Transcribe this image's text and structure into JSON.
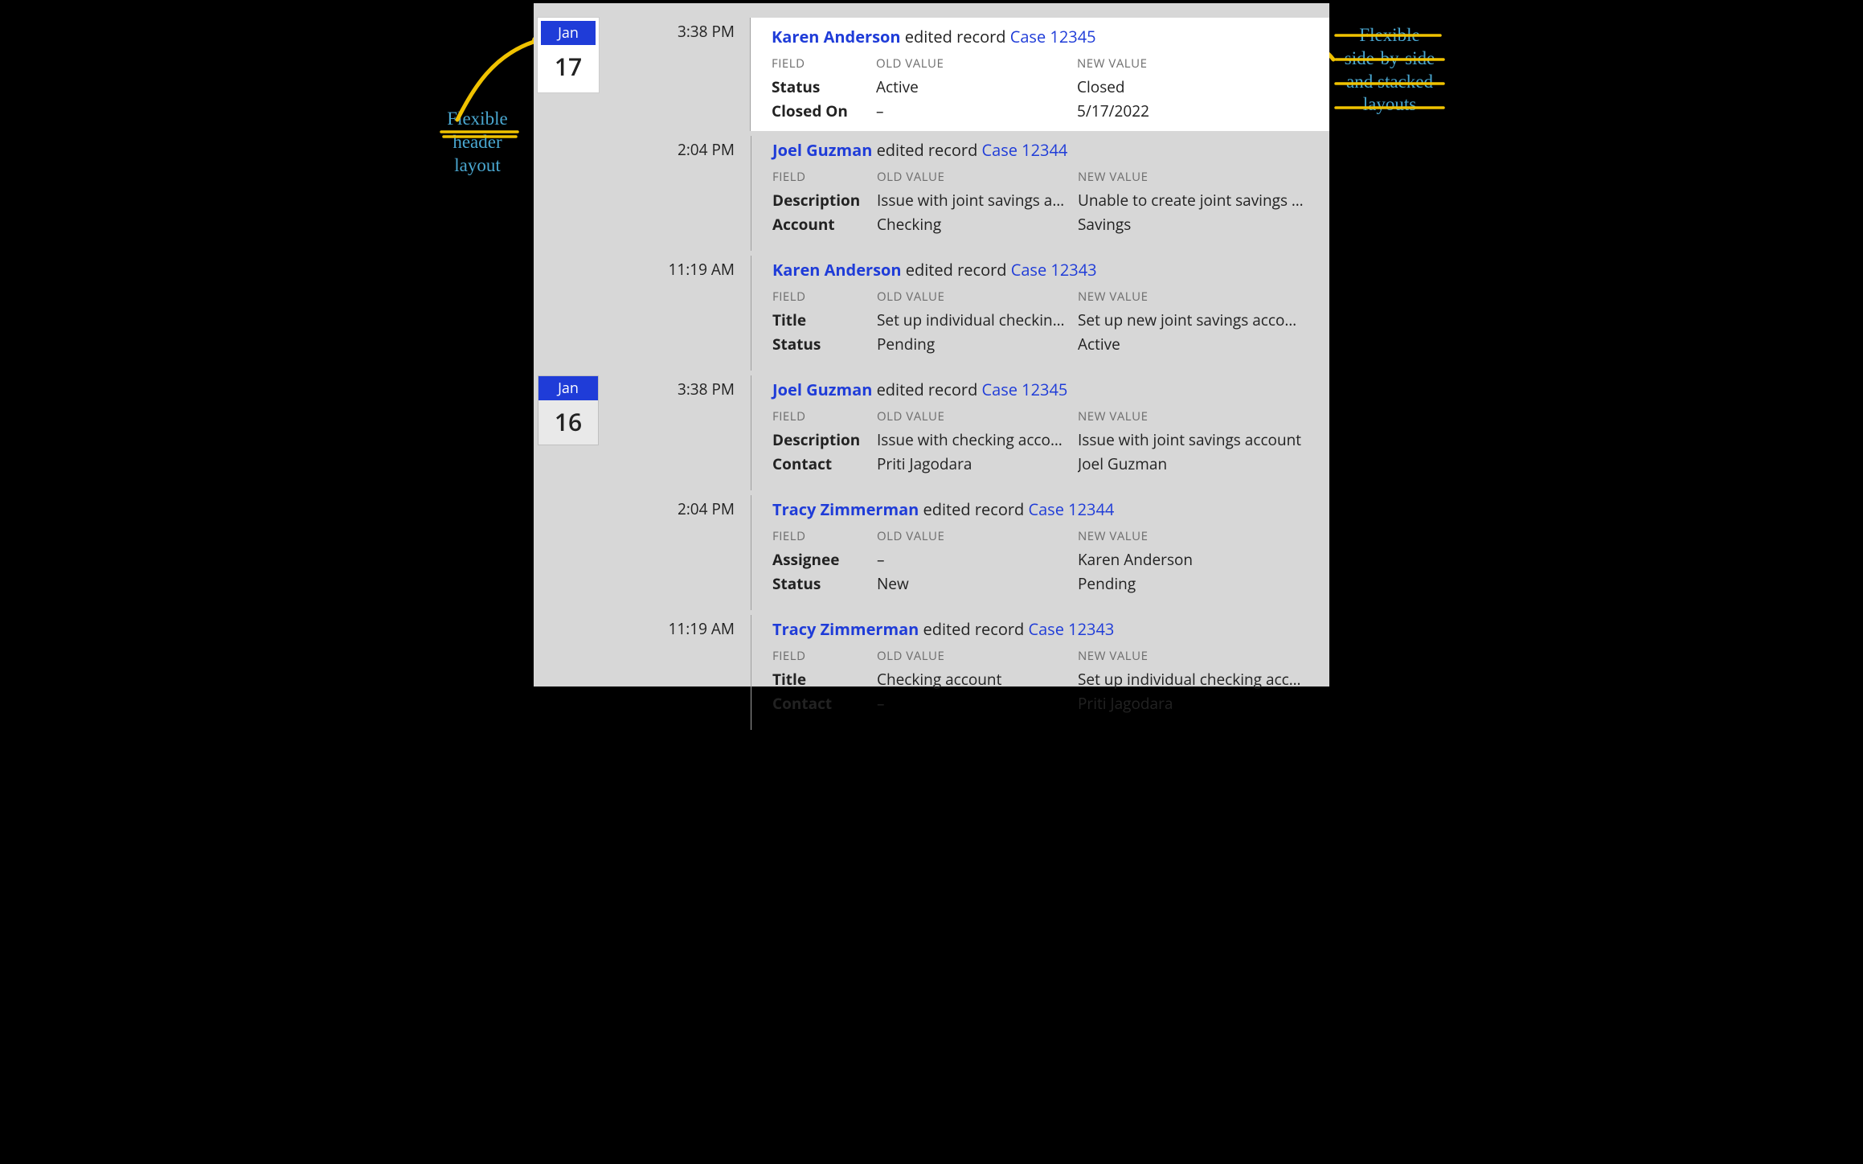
{
  "colors": {
    "accent_blue": "#1f3cd8",
    "annotation_text": "#4aa7d0",
    "annotation_line": "#f0c200",
    "panel_bg": "#d7d7d7",
    "header_gray": "#6d6d6d"
  },
  "column_headers": {
    "field": "FIELD",
    "old_value": "OLD VALUE",
    "new_value": "NEW VALUE"
  },
  "action_text": "edited record",
  "annotations": {
    "left": "Flexible\nheader\nlayout",
    "right": "Flexible\nside-by-side\nand stacked\nlayouts"
  },
  "days": [
    {
      "month": "Jan",
      "day": "17",
      "highlighted": true,
      "events": [
        {
          "time": "3:38 PM",
          "highlighted": true,
          "user": "Karen Anderson",
          "case": "Case 12345",
          "changes": [
            {
              "field": "Status",
              "old": "Active",
              "new": "Closed"
            },
            {
              "field": "Closed On",
              "old": "–",
              "new": "5/17/2022"
            }
          ]
        },
        {
          "time": "2:04 PM",
          "user": "Joel Guzman",
          "case": "Case 12344",
          "changes": [
            {
              "field": "Description",
              "old": "Issue with joint savings account",
              "new": "Unable to create joint savings …"
            },
            {
              "field": "Account",
              "old": "Checking",
              "new": "Savings"
            }
          ]
        },
        {
          "time": "11:19 AM",
          "user": "Karen Anderson",
          "case": "Case 12343",
          "changes": [
            {
              "field": "Title",
              "old": "Set up individual checking acc…",
              "new": "Set up new joint savings acco…"
            },
            {
              "field": "Status",
              "old": "Pending",
              "new": "Active"
            }
          ]
        }
      ]
    },
    {
      "month": "Jan",
      "day": "16",
      "highlighted": false,
      "events": [
        {
          "time": "3:38 PM",
          "user": "Joel Guzman",
          "case": "Case 12345",
          "changes": [
            {
              "field": "Description",
              "old": "Issue with checking account",
              "new": "Issue with joint savings account"
            },
            {
              "field": "Contact",
              "old": "Priti Jagodara",
              "new": "Joel Guzman"
            }
          ]
        },
        {
          "time": "2:04 PM",
          "user": "Tracy Zimmerman",
          "case": "Case 12344",
          "changes": [
            {
              "field": "Assignee",
              "old": "–",
              "new": "Karen Anderson"
            },
            {
              "field": "Status",
              "old": "New",
              "new": "Pending"
            }
          ]
        },
        {
          "time": "11:19 AM",
          "user": "Tracy Zimmerman",
          "case": "Case 12343",
          "changes": [
            {
              "field": "Title",
              "old": "Checking account",
              "new": "Set up individual checking acc…"
            },
            {
              "field": "Contact",
              "old": "–",
              "new": "Priti Jagodara"
            }
          ]
        }
      ]
    }
  ]
}
